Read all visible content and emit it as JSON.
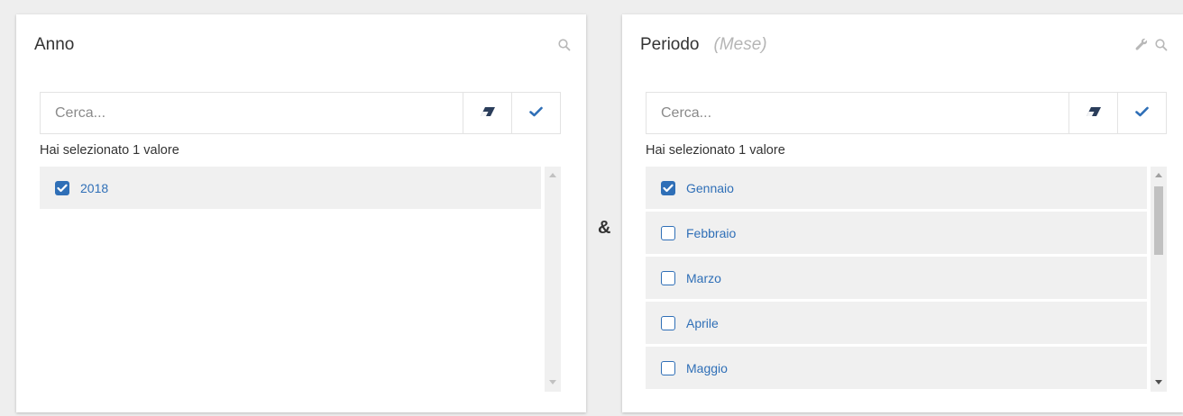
{
  "operator": "&",
  "left_panel": {
    "title": "Anno",
    "search_placeholder": "Cerca...",
    "selection_info": "Hai selezionato 1 valore",
    "items": [
      {
        "label": "2018",
        "checked": true
      }
    ]
  },
  "right_panel": {
    "title": "Periodo",
    "subtitle": "(Mese)",
    "search_placeholder": "Cerca...",
    "selection_info": "Hai selezionato 1 valore",
    "items": [
      {
        "label": "Gennaio",
        "checked": true
      },
      {
        "label": "Febbraio",
        "checked": false
      },
      {
        "label": "Marzo",
        "checked": false
      },
      {
        "label": "Aprile",
        "checked": false
      },
      {
        "label": "Maggio",
        "checked": false
      }
    ]
  },
  "icons": {
    "search": "search-icon",
    "wrench": "wrench-icon",
    "eraser": "eraser-icon",
    "confirm": "checkmark-icon"
  },
  "colors": {
    "accent": "#2f6fb7",
    "item_bg": "#f0f0f0"
  }
}
